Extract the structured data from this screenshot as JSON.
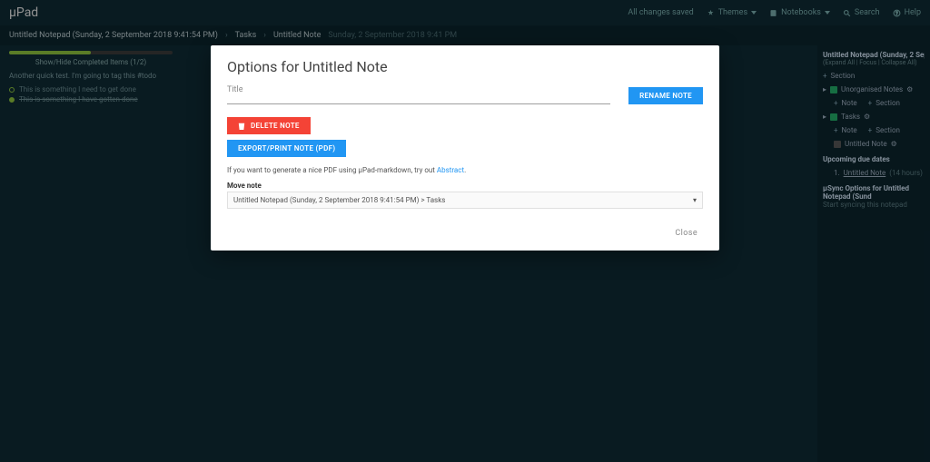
{
  "topbar": {
    "brand": "µPad",
    "saved": "All changes saved",
    "themes": "Themes",
    "notebooks": "Notebooks",
    "search": "Search",
    "help": "Help"
  },
  "breadcrumb": {
    "notebook": "Untitled Notepad (Sunday, 2 September 2018 9:41:54 PM)",
    "section": "Tasks",
    "note": "Untitled Note",
    "timestamp": "Sunday, 2 September 2018 9:41 PM"
  },
  "leftpane": {
    "progress_label": "Show/Hide Completed Items (1/2)",
    "quick_text": "Another quick test. I'm going to tag this #todo",
    "tasks": [
      {
        "label": "This is something I need to get done",
        "done": false
      },
      {
        "label": "This is something I have gotten done",
        "done": true
      }
    ]
  },
  "rightpane": {
    "title": "Untitled Notepad (Sunday, 2 September 2",
    "subtitle": "(Expand All | Focus | Collapse All)",
    "add_section": "Section",
    "unorganised": "Unorganised Notes",
    "add_note": "Note",
    "add_sub_section": "Section",
    "tasks_section": "Tasks",
    "untitled_note": "Untitled Note",
    "due_heading": "Upcoming due dates",
    "due_item": "Untitled Note",
    "due_time": "(14 hours)",
    "sync_heading": "µSync Options for Untitled Notepad (Sund",
    "sync_sub": "Start syncing this notepad"
  },
  "modal": {
    "heading": "Options for Untitled Note",
    "title_label": "Title",
    "rename": "Rename Note",
    "delete": "Delete Note",
    "export": "Export/Print Note (PDF)",
    "hint_pre": "If you want to generate a nice PDF using µPad-markdown, try out ",
    "hint_link": "Abstract",
    "move_label": "Move note",
    "move_value": "Untitled Notepad (Sunday, 2 September 2018 9:41:54 PM) > Tasks",
    "close": "Close"
  }
}
